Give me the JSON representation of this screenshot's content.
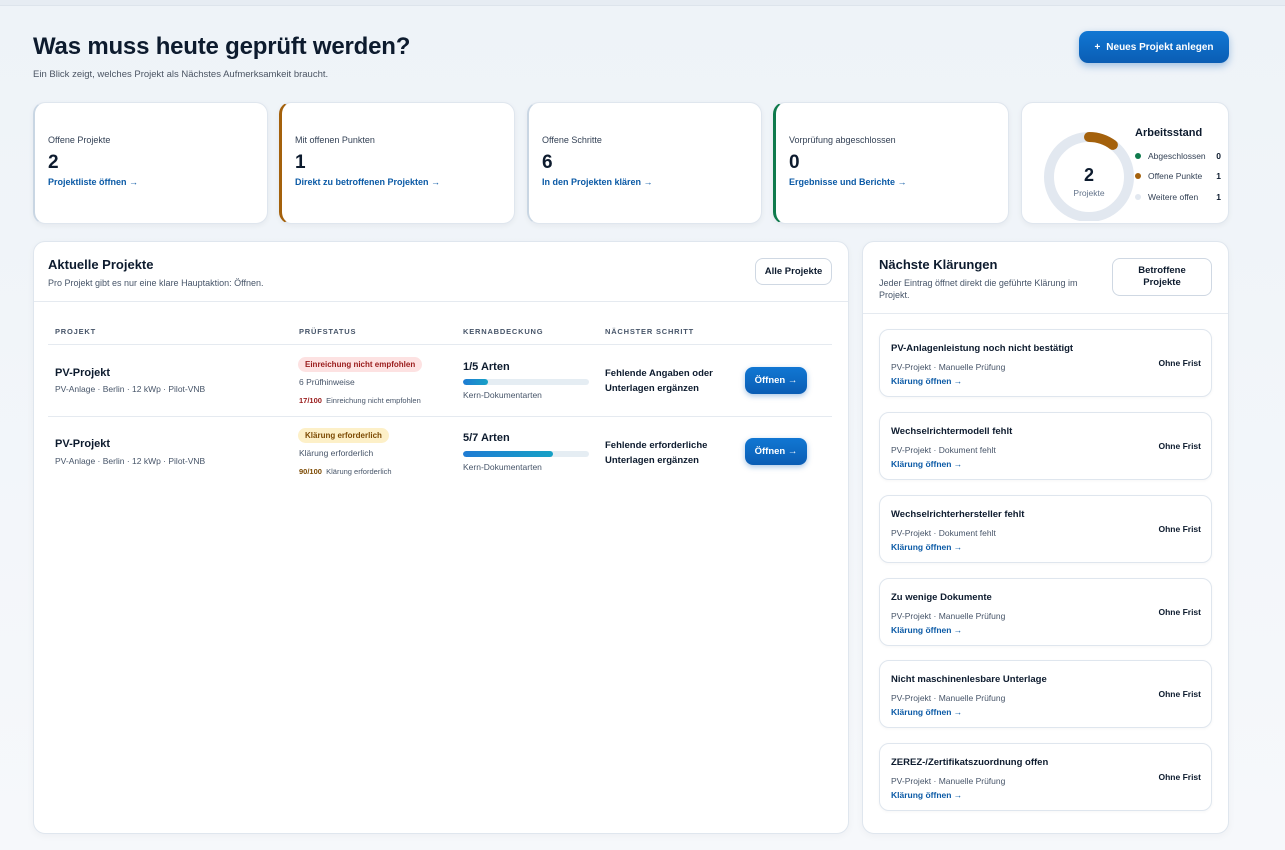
{
  "header": {
    "title": "Was muss heute geprüft werden?",
    "subtitle": "Ein Blick zeigt, welches Projekt als Nächstes Aufmerksamkeit braucht.",
    "new_project_icon": "+",
    "new_project_label": "Neues Projekt anlegen"
  },
  "colors": {
    "primary": "#0a66c2",
    "accent_amber": "#a4610c",
    "accent_green": "#0f7a4c",
    "link": "#0b5aa6"
  },
  "stats": [
    {
      "label": "Offene Projekte",
      "value": "2",
      "link": "Projektliste öffnen →"
    },
    {
      "label": "Mit offenen Punkten",
      "value": "1",
      "link": "Direkt zu betroffenen Projekten →"
    },
    {
      "label": "Offene Schritte",
      "value": "6",
      "link": "In den Projekten klären →"
    },
    {
      "label": "Vorprüfung abgeschlossen",
      "value": "0",
      "link": "Ergebnisse und Berichte →"
    }
  ],
  "work_status": {
    "title": "Arbeitsstand",
    "total": "2",
    "total_label": "Projekte",
    "legend": [
      {
        "label": "Abgeschlossen",
        "count": "0",
        "color": "#0f7a4c"
      },
      {
        "label": "Offene Punkte",
        "count": "1",
        "color": "#a4610c"
      },
      {
        "label": "Weitere offen",
        "count": "1",
        "color": "#e2e8f0"
      }
    ]
  },
  "projects_panel": {
    "title": "Aktuelle Projekte",
    "subtitle": "Pro Projekt gibt es nur eine klare Hauptaktion: Öffnen.",
    "all_button": "Alle Projekte",
    "columns": [
      "Projekt",
      "Prüfstatus",
      "Kernabdeckung",
      "Nächster Schritt"
    ],
    "rows": [
      {
        "name": "PV-Projekt",
        "meta": "PV-Anlage · Berlin · 12 kWp · Pilot-VNB",
        "badge": "Einreichung nicht empfohlen",
        "badge_tone": "red",
        "hints": "6 Prüfhinweise",
        "score": "17/100",
        "score_label": "Einreichung nicht empfohlen",
        "coverage": "1/5 Arten",
        "coverage_ratio": 0.2,
        "coverage_label": "Kern-Dokumentarten",
        "next_step": "Fehlende Angaben oder Unterlagen ergänzen",
        "open_label": "Öffnen →"
      },
      {
        "name": "PV-Projekt",
        "meta": "PV-Anlage · Berlin · 12 kWp · Pilot-VNB",
        "badge": "Klärung erforderlich",
        "badge_tone": "amber",
        "hints": "Klärung erforderlich",
        "score": "90/100",
        "score_label": "Klärung erforderlich",
        "coverage": "5/7 Arten",
        "coverage_ratio": 0.714,
        "coverage_label": "Kern-Dokumentarten",
        "next_step": "Fehlende erforderliche Unterlagen ergänzen",
        "open_label": "Öffnen →"
      }
    ]
  },
  "clarifications_panel": {
    "title": "Nächste Klärungen",
    "subtitle": "Jeder Eintrag öffnet direkt die geführte Klärung im Projekt.",
    "affected_button": "Betroffene Projekte",
    "items": [
      {
        "title": "PV-Anlagenleistung noch nicht bestätigt",
        "meta": "PV-Projekt · Manuelle Prüfung",
        "link": "Klärung öffnen →",
        "deadline": "Ohne Frist"
      },
      {
        "title": "Wechselrichtermodell fehlt",
        "meta": "PV-Projekt · Dokument fehlt",
        "link": "Klärung öffnen →",
        "deadline": "Ohne Frist"
      },
      {
        "title": "Wechselrichterhersteller fehlt",
        "meta": "PV-Projekt · Dokument fehlt",
        "link": "Klärung öffnen →",
        "deadline": "Ohne Frist"
      },
      {
        "title": "Zu wenige Dokumente",
        "meta": "PV-Projekt · Manuelle Prüfung",
        "link": "Klärung öffnen →",
        "deadline": "Ohne Frist"
      },
      {
        "title": "Nicht maschinenlesbare Unterlage",
        "meta": "PV-Projekt · Manuelle Prüfung",
        "link": "Klärung öffnen →",
        "deadline": "Ohne Frist"
      },
      {
        "title": "ZEREZ-/Zertifikatszuordnung offen",
        "meta": "PV-Projekt · Manuelle Prüfung",
        "link": "Klärung öffnen →",
        "deadline": "Ohne Frist"
      }
    ]
  }
}
